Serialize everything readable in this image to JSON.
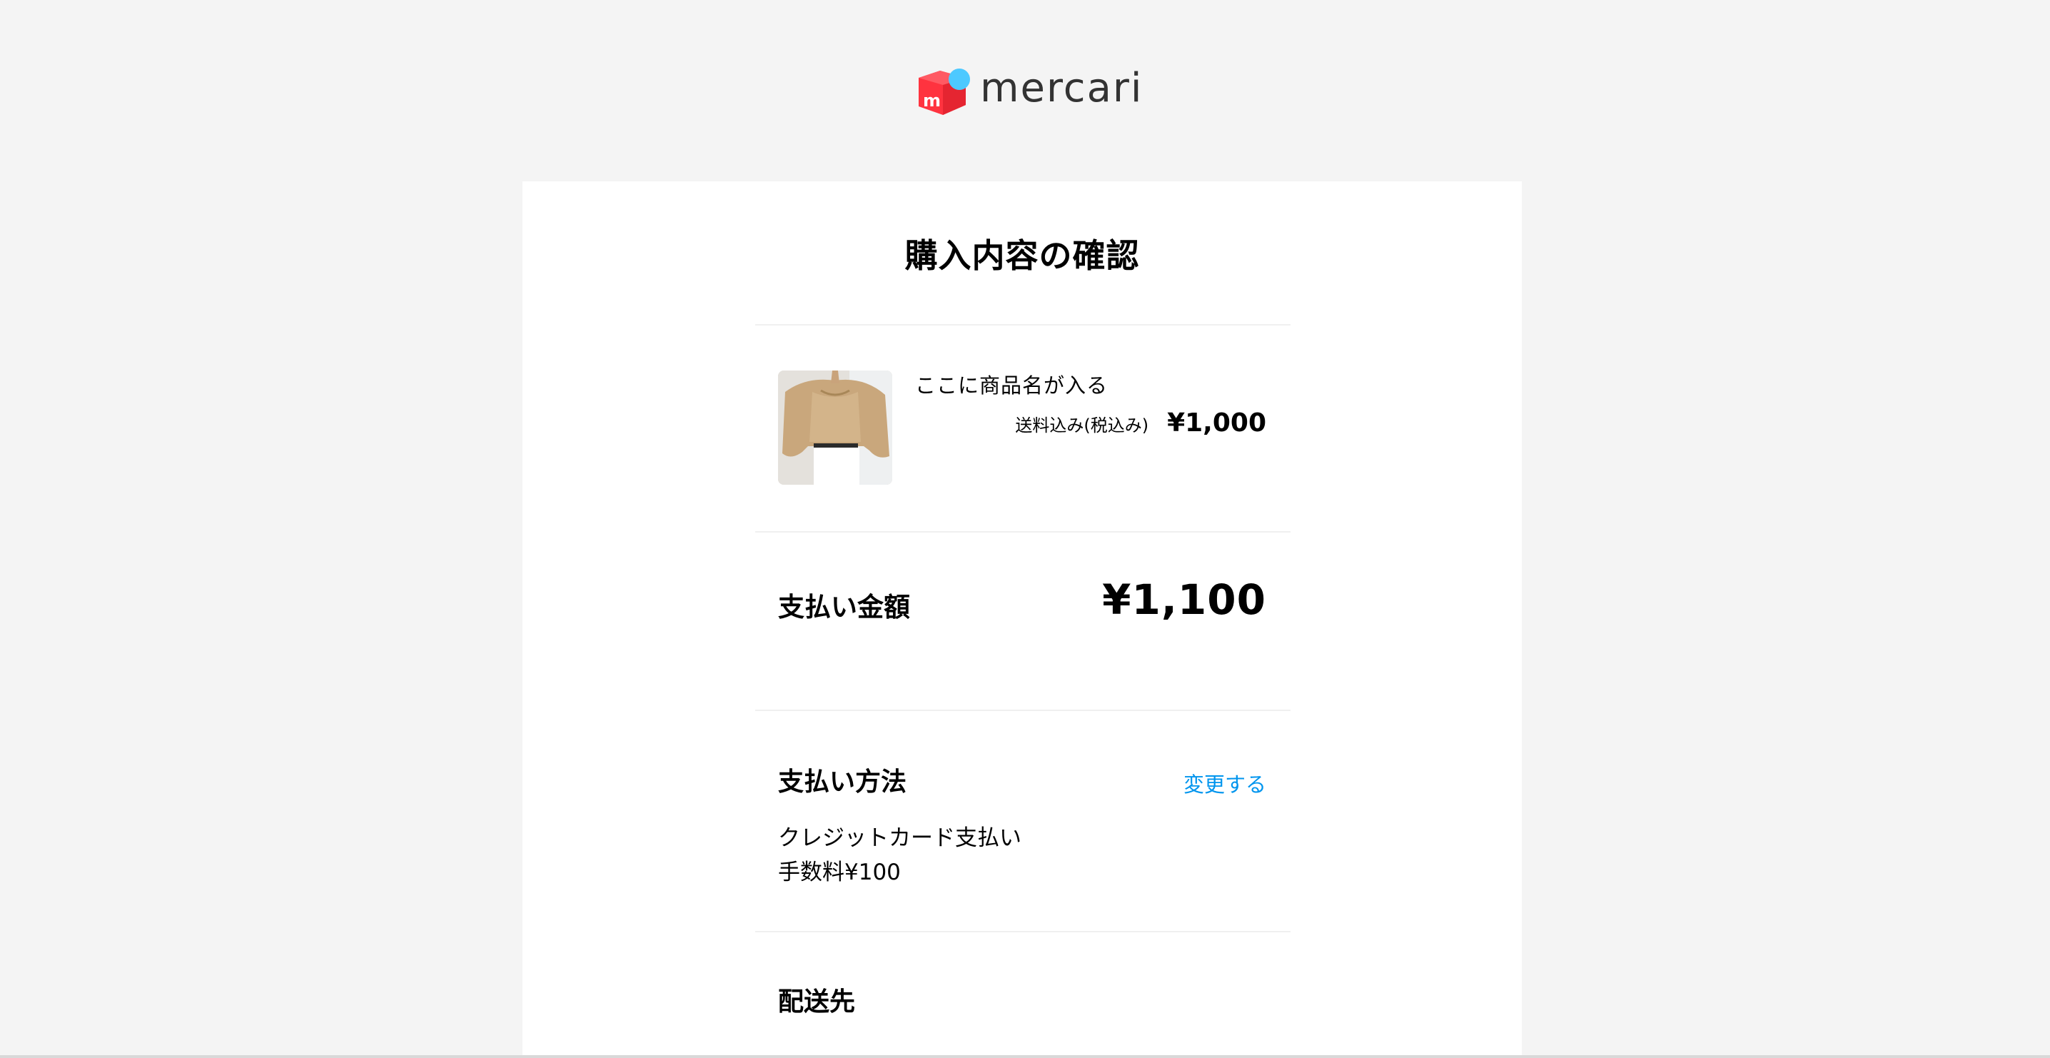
{
  "brand": {
    "name": "mercari",
    "colors": {
      "logo_red": "#ff333f",
      "logo_blue": "#4dc9ff",
      "link_blue": "#0095ee",
      "background": "#f4f4f4"
    }
  },
  "page": {
    "title": "購入内容の確認"
  },
  "product": {
    "name": "ここに商品名が入る",
    "shipping_note": "送料込み(税込み)",
    "price": "¥1,000",
    "image_icon": "product-photo"
  },
  "total": {
    "label": "支払い金額",
    "amount": "¥1,100"
  },
  "payment": {
    "heading": "支払い方法",
    "change_label": "変更する",
    "method": "クレジットカード支払い",
    "fee": "手数料¥100"
  },
  "shipping": {
    "heading": "配送先"
  }
}
